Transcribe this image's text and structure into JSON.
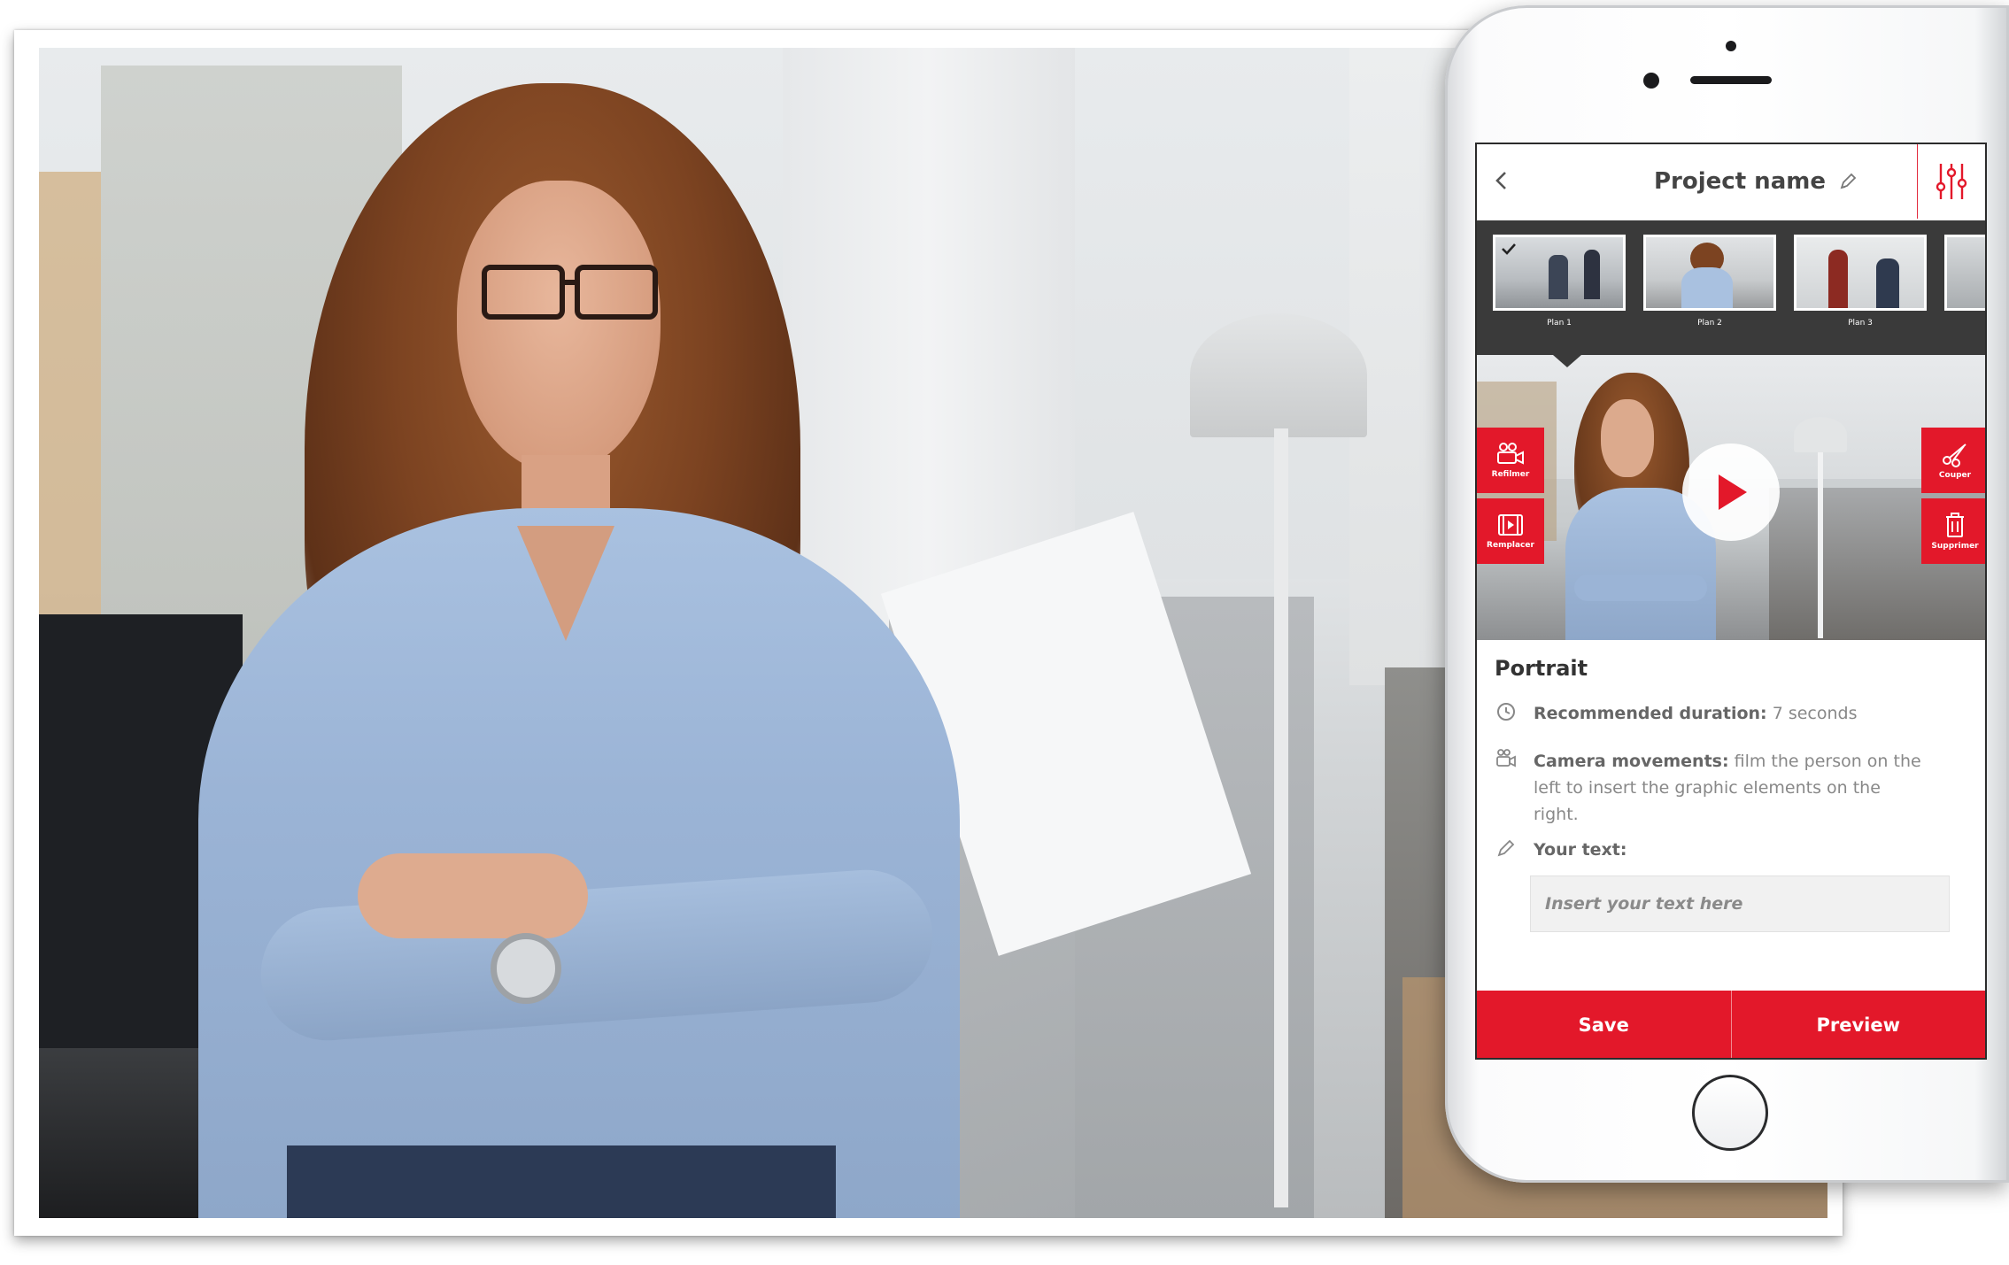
{
  "app": {
    "project_name": "Project name"
  },
  "thumbnails": [
    {
      "label": "Plan 1",
      "selected": true
    },
    {
      "label": "Plan 2",
      "selected": false
    },
    {
      "label": "Plan 3",
      "selected": false
    }
  ],
  "preview_actions": {
    "left_top": "Refilmer",
    "left_bottom": "Remplacer",
    "right_top": "Couper",
    "right_bottom": "Supprimer"
  },
  "shot": {
    "title": "Portrait",
    "duration_label": "Recommended duration:",
    "duration_value": "7 seconds",
    "camera_label": "Camera movements:",
    "camera_value": "film the person on the left to insert the graphic elements on the right.",
    "text_label": "Your text:",
    "text_placeholder": "Insert your text here",
    "text_value": ""
  },
  "footer": {
    "save_label": "Save",
    "preview_label": "Preview"
  },
  "colors": {
    "accent": "#e3182a",
    "thumb_strip": "#3a3a3a"
  },
  "icons": [
    "back-icon",
    "pencil-icon",
    "sliders-icon",
    "check-icon",
    "camera-icon",
    "film-icon",
    "scissors-icon",
    "trash-icon",
    "play-icon",
    "clock-icon",
    "home-button"
  ]
}
